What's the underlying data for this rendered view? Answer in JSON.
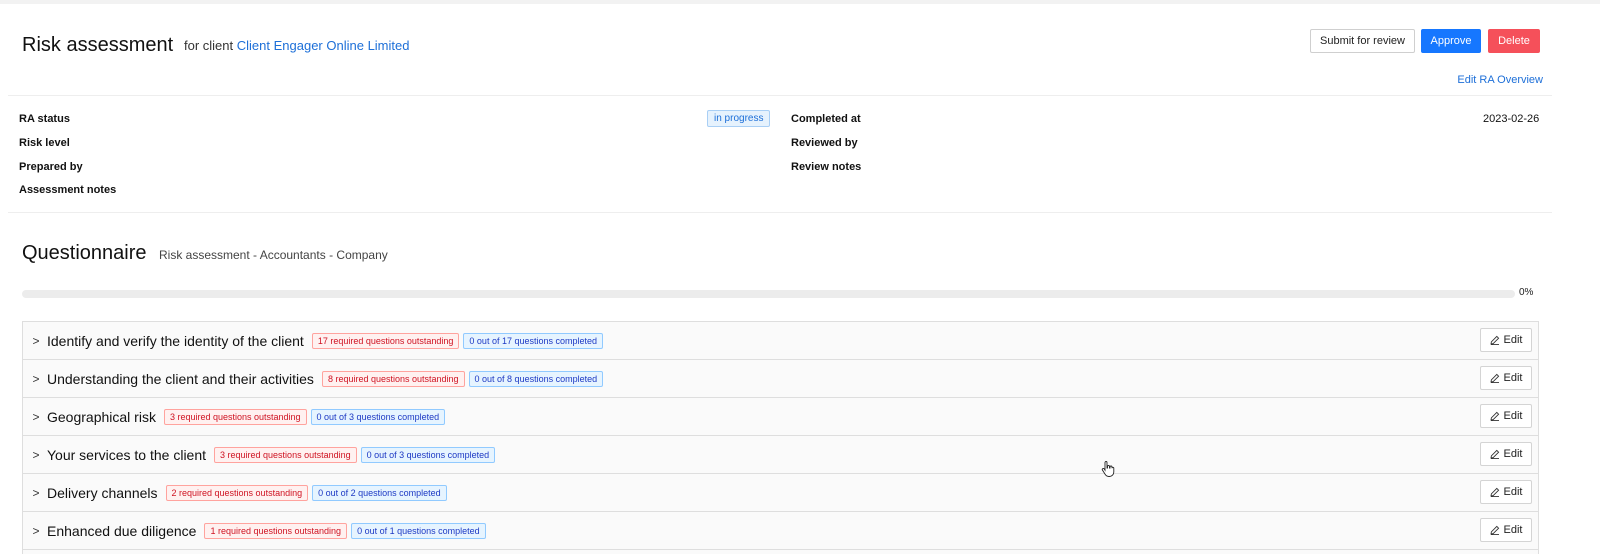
{
  "header": {
    "title": "Risk assessment",
    "for_prefix": "for client",
    "client_name": "Client Engager Online Limited",
    "submit_label": "Submit for review",
    "approve_label": "Approve",
    "delete_label": "Delete",
    "edit_overview_label": "Edit RA Overview"
  },
  "overview": {
    "ra_status_label": "RA status",
    "ra_status_value": "in progress",
    "risk_level_label": "Risk level",
    "prepared_by_label": "Prepared by",
    "assessment_notes_label": "Assessment notes",
    "completed_at_label": "Completed at",
    "completed_at_value": "2023-02-26",
    "reviewed_by_label": "Reviewed by",
    "review_notes_label": "Review notes"
  },
  "questionnaire": {
    "title": "Questionnaire",
    "subtitle": "Risk assessment - Accountants - Company",
    "progress_label": "0%",
    "progress_value": 0,
    "edit_label": "Edit",
    "sections": [
      {
        "title": "Identify and verify the identity of the client",
        "required": "17 required questions outstanding",
        "completed": "0 out of 17 questions completed"
      },
      {
        "title": "Understanding the client and their activities",
        "required": "8 required questions outstanding",
        "completed": "0 out of 8 questions completed"
      },
      {
        "title": "Geographical risk",
        "required": "3 required questions outstanding",
        "completed": "0 out of 3 questions completed"
      },
      {
        "title": "Your services to the client",
        "required": "3 required questions outstanding",
        "completed": "0 out of 3 questions completed"
      },
      {
        "title": "Delivery channels",
        "required": "2 required questions outstanding",
        "completed": "0 out of 2 questions completed"
      },
      {
        "title": "Enhanced due diligence",
        "required": "1 required questions outstanding",
        "completed": "0 out of 1 questions completed"
      }
    ]
  },
  "colors": {
    "primary": "#1677ff",
    "danger": "#f5505a",
    "link": "#1d6fd8"
  }
}
